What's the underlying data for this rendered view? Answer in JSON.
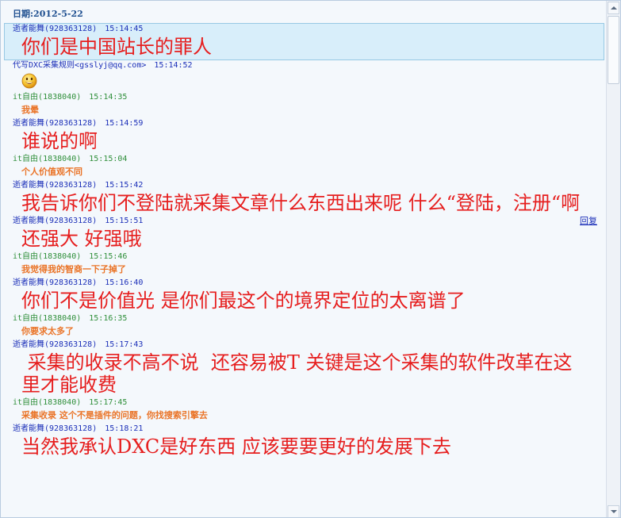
{
  "header": {
    "date_label": "日期:2012-5-22"
  },
  "messages": [
    {
      "name": "逝者能舞",
      "id": "(928363128)",
      "time": "15:14:45",
      "text": "你们是中国站长的罪人",
      "style": "big",
      "color": "blue"
    },
    {
      "name": "代写DXC采集规则<gsslyj@qq.com>",
      "id": "",
      "time": "15:14:52",
      "text": "",
      "style": "emoji",
      "emoji": "smile-icon",
      "color": "blue"
    },
    {
      "name": "it自由",
      "id": "(1838040)",
      "time": "15:14:35",
      "text": "我晕",
      "style": "small",
      "color": "green"
    },
    {
      "name": "逝者能舞",
      "id": "(928363128)",
      "time": "15:14:59",
      "text": "谁说的啊",
      "style": "big",
      "color": "blue"
    },
    {
      "name": "it自由",
      "id": "(1838040)",
      "time": "15:15:04",
      "text": "个人价值观不同",
      "style": "small",
      "color": "green"
    },
    {
      "name": "逝者能舞",
      "id": "(928363128)",
      "time": "15:15:42",
      "text": "我告诉你们不登陆就采集文章什么东西出来呢 什么“登陆，注册“啊",
      "style": "big",
      "color": "blue"
    },
    {
      "name": "逝者能舞",
      "id": "(928363128)",
      "time": "15:15:51",
      "text": "还强大 好强哦",
      "style": "big",
      "color": "blue",
      "reply": "回复"
    },
    {
      "name": "it自由",
      "id": "(1838040)",
      "time": "15:15:46",
      "text": "我觉得我的智商一下子掉了",
      "style": "small",
      "color": "green"
    },
    {
      "name": "逝者能舞",
      "id": "(928363128)",
      "time": "15:16:40",
      "text": "你们不是价值光 是你们最这个的境界定位的太离谱了",
      "style": "big",
      "color": "blue"
    },
    {
      "name": "it自由",
      "id": "(1838040)",
      "time": "15:16:35",
      "text": "你要求太多了",
      "style": "small",
      "color": "green"
    },
    {
      "name": "逝者能舞",
      "id": "(928363128)",
      "time": "15:17:43",
      "text": " 采集的收录不高不说  还容易被T 关键是这个采集的软件改革在这里才能收费",
      "style": "big",
      "color": "blue"
    },
    {
      "name": "it自由",
      "id": "(1838040)",
      "time": "15:17:45",
      "text": "采集收录 这个不是插件的问题，你找搜索引擎去",
      "style": "small",
      "color": "green"
    },
    {
      "name": "逝者能舞",
      "id": "(928363128)",
      "time": "15:18:21",
      "text": "当然我承认DXC是好东西 应该要要更好的发展下去",
      "style": "big",
      "color": "blue"
    }
  ],
  "colors": {
    "accent": "#1d4e8f",
    "big_text": "#e61e1e",
    "small_text": "#ea7428",
    "blue_name": "#1b2fb8",
    "green_name": "#2f8f3a",
    "selected_bg": "#d8eefa"
  },
  "icons": {
    "scroll_up": "chevron-up-icon",
    "scroll_down": "chevron-down-icon",
    "emoji": "smile-icon"
  }
}
